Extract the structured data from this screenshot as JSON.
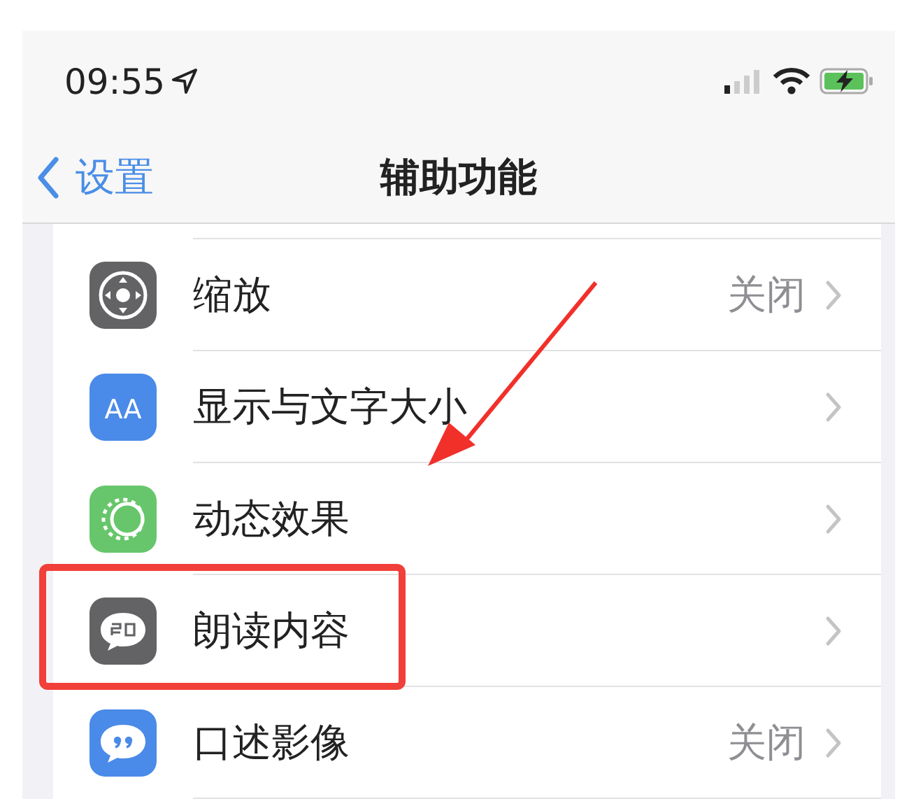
{
  "status_bar": {
    "time": "09:55"
  },
  "nav": {
    "back_label": "设置",
    "title": "辅助功能"
  },
  "rows": [
    {
      "kind": "zoom",
      "label": "缩放",
      "value": "关闭",
      "highlighted": false
    },
    {
      "kind": "text",
      "icon_text": "AA",
      "label": "显示与文字大小",
      "highlighted": false
    },
    {
      "kind": "motion",
      "label": "动态效果",
      "highlighted": false
    },
    {
      "kind": "speech",
      "label": "朗读内容",
      "highlighted": true
    },
    {
      "kind": "quote",
      "label": "口述影像",
      "value": "关闭",
      "highlighted": false
    }
  ]
}
